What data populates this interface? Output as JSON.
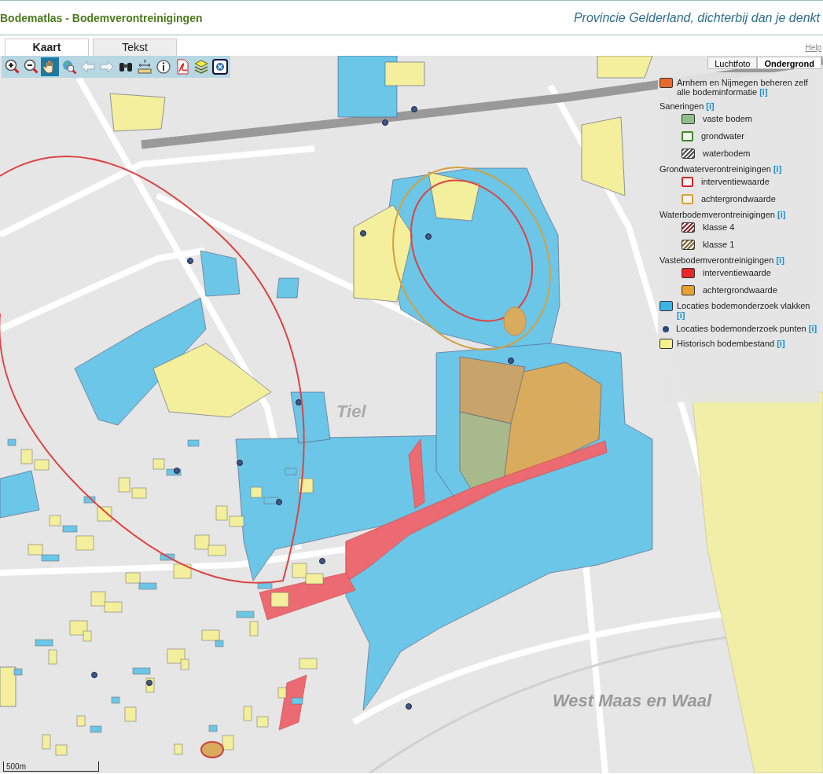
{
  "header": {
    "title": "Bodematlas - Bodemverontreinigingen",
    "slogan": "Provincie Gelderland, dichterbij dan je denkt"
  },
  "tabs": [
    {
      "label": "Kaart",
      "selected": true
    },
    {
      "label": "Tekst",
      "selected": false
    }
  ],
  "help_link": "Help",
  "toolbar": [
    {
      "kind": "zoom-in",
      "selected": false
    },
    {
      "kind": "zoom-out",
      "selected": false
    },
    {
      "kind": "pan",
      "selected": true
    },
    {
      "kind": "full-extent",
      "selected": false
    },
    {
      "kind": "previous",
      "selected": false
    },
    {
      "kind": "next",
      "selected": false
    },
    {
      "kind": "find",
      "selected": false
    },
    {
      "kind": "measure",
      "selected": false
    },
    {
      "kind": "info",
      "selected": false
    },
    {
      "kind": "pdf",
      "selected": false
    },
    {
      "kind": "layers",
      "selected": false
    },
    {
      "kind": "close",
      "selected": false
    }
  ],
  "basemaps": [
    {
      "label": "Luchtfoto",
      "selected": false
    },
    {
      "label": "Ondergrond",
      "selected": true
    }
  ],
  "legend": [
    {
      "kind": "fill",
      "label": "Arnhem en Nijmegen beheren zelf alle bodeminformatie",
      "color": "#e8692a",
      "info": "[i]"
    },
    {
      "kind": "group",
      "label": "Saneringen",
      "info": "[i]",
      "items": [
        {
          "kind": "fill",
          "label": "vaste bodem",
          "color": "#8fc08a"
        },
        {
          "kind": "outline",
          "label": "grondwater",
          "color": "#3d8a2a"
        },
        {
          "kind": "hatch",
          "label": "waterbodem",
          "color": "#555555"
        }
      ]
    },
    {
      "kind": "group",
      "label": "Grondwaterverontreinigingen",
      "info": "[i]",
      "items": [
        {
          "kind": "outline",
          "label": "interventiewaarde",
          "color": "#d0262c"
        },
        {
          "kind": "outline",
          "label": "achtergrondwaarde",
          "color": "#dca032"
        }
      ]
    },
    {
      "kind": "group",
      "label": "Waterbodemverontreinigingen",
      "info": "[i]",
      "items": [
        {
          "kind": "hatch",
          "label": "klasse 4",
          "color": "#8a3038"
        },
        {
          "kind": "hatch",
          "label": "klasse 1",
          "color": "#8a7040"
        }
      ]
    },
    {
      "kind": "group",
      "label": "Vastebodemverontreinigingen",
      "info": "[i]",
      "items": [
        {
          "kind": "fill",
          "label": "interventiewaarde",
          "color": "#e8262c"
        },
        {
          "kind": "fill",
          "label": "achtergrondwaarde",
          "color": "#e8a030"
        }
      ]
    },
    {
      "kind": "fill",
      "label": "Locaties bodemonderzoek vlakken",
      "color": "#3cb4e8",
      "info": "[i]"
    },
    {
      "kind": "dot",
      "label": "Locaties bodemonderzoek punten",
      "color": "#2a4a7a",
      "info": "[i]"
    },
    {
      "kind": "fill",
      "label": "Historisch bodembestand",
      "color": "#f4f08a",
      "info": "[i]"
    }
  ],
  "map_labels": [
    {
      "label": "Tiel",
      "kind": "town"
    },
    {
      "label": "West Maas en Waal",
      "kind": "municipality"
    }
  ],
  "scale": "500m"
}
